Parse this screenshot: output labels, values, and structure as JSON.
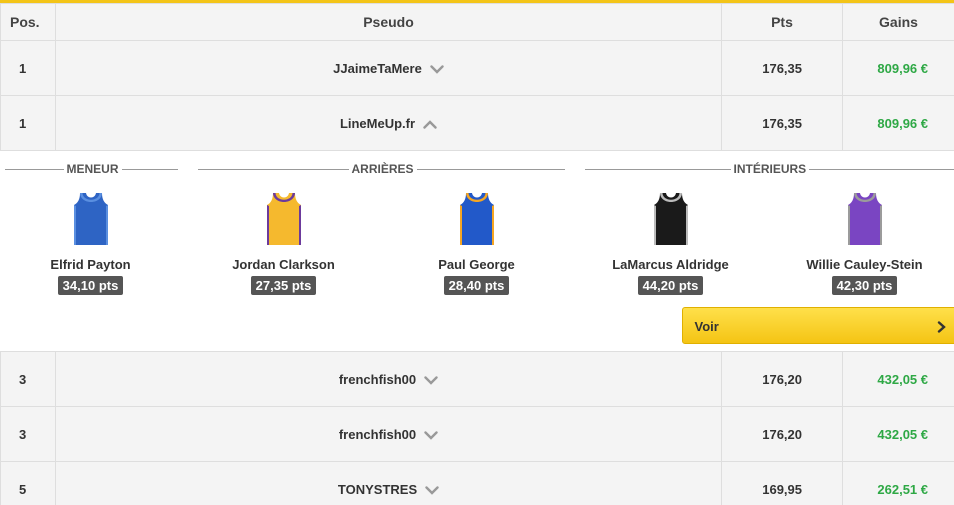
{
  "header": {
    "pos": "Pos.",
    "pseudo": "Pseudo",
    "pts": "Pts",
    "gains": "Gains"
  },
  "rows_top": [
    {
      "pos": "1",
      "pseudo": "JJaimeTaMere",
      "pts": "176,35",
      "gains": "809,96 €",
      "expanded": false
    },
    {
      "pos": "1",
      "pseudo": "LineMeUp.fr",
      "pts": "176,35",
      "gains": "809,96 €",
      "expanded": true
    }
  ],
  "lineup": {
    "groups": {
      "meneur": "MENEUR",
      "arrieres": "ARRIÈRES",
      "interieurs": "INTÉRIEURS"
    },
    "players": [
      {
        "name": "Elfrid Payton",
        "pts": "34,10 pts",
        "jersey_color": "#2e64c4",
        "trim_color": "#5a8fe0"
      },
      {
        "name": "Jordan Clarkson",
        "pts": "27,35 pts",
        "jersey_color": "#f5b92e",
        "trim_color": "#6c3a9c"
      },
      {
        "name": "Paul George",
        "pts": "28,40 pts",
        "jersey_color": "#2259c9",
        "trim_color": "#f5a623"
      },
      {
        "name": "LaMarcus Aldridge",
        "pts": "44,20 pts",
        "jersey_color": "#1a1a1a",
        "trim_color": "#bbbbbb"
      },
      {
        "name": "Willie Cauley-Stein",
        "pts": "42,30 pts",
        "jersey_color": "#7a45c2",
        "trim_color": "#9b9b9b"
      }
    ],
    "voir_label": "Voir"
  },
  "rows_bottom": [
    {
      "pos": "3",
      "pseudo": "frenchfish00",
      "pts": "176,20",
      "gains": "432,05 €"
    },
    {
      "pos": "3",
      "pseudo": "frenchfish00",
      "pts": "176,20",
      "gains": "432,05 €"
    },
    {
      "pos": "5",
      "pseudo": "TONYSTRES",
      "pts": "169,95",
      "gains": "262,51 €"
    }
  ],
  "colors": {
    "accent": "#f3c417",
    "gains": "#2ea845",
    "badge": "#555555"
  },
  "icons": {
    "collapsed": "chevron-down-icon",
    "expanded": "chevron-up-icon",
    "voir_arrow": "chevron-right-icon"
  }
}
